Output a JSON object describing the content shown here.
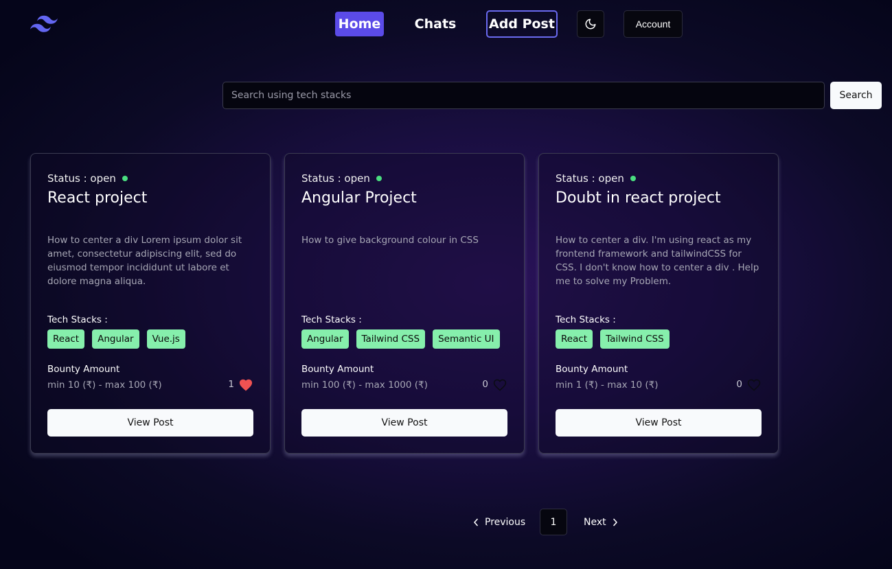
{
  "colors": {
    "accent": "#5b4be8",
    "add_post_border": "#6a6af0",
    "status_open": "#4ade80",
    "tag_bg": "#86efac",
    "heart_filled": "#f05252",
    "logo": "#6366f1"
  },
  "nav": {
    "logo_icon": "tailwind-logo-icon",
    "home_label": "Home",
    "chats_label": "Chats",
    "add_post_label": "Add Post",
    "theme_icon": "moon-icon",
    "account_label": "Account"
  },
  "search": {
    "placeholder": "Search using tech stacks",
    "value": "",
    "button_label": "Search"
  },
  "posts": [
    {
      "status_prefix": "Status : ",
      "status": "open",
      "title": "React project",
      "description": "How to center a div Lorem ipsum dolor sit amet, consectetur adipiscing elit, sed do eiusmod tempor incididunt ut labore et dolore magna aliqua.",
      "tech_label": "Tech Stacks :",
      "tags": [
        "React",
        "Angular",
        "Vue.js"
      ],
      "bounty_label": "Bounty Amount",
      "bounty_range": "min 10 (₹) - max 100 (₹)",
      "likes": "1",
      "liked": true,
      "view_label": "View Post"
    },
    {
      "status_prefix": "Status : ",
      "status": "open",
      "title": "Angular Project",
      "description": "How to give background colour in CSS",
      "tech_label": "Tech Stacks :",
      "tags": [
        "Angular",
        "Tailwind CSS",
        "Semantic UI"
      ],
      "bounty_label": "Bounty Amount",
      "bounty_range": "min 100 (₹) - max 1000 (₹)",
      "likes": "0",
      "liked": false,
      "view_label": "View Post"
    },
    {
      "status_prefix": "Status : ",
      "status": "open",
      "title": "Doubt in react project",
      "description": "How to center a div. I'm using react as my frontend framework and tailwindCSS for CSS. I don't know how to center a div . Help me to solve my Problem.",
      "tech_label": "Tech Stacks :",
      "tags": [
        "React",
        "Tailwind CSS"
      ],
      "bounty_label": "Bounty Amount",
      "bounty_range": "min 1 (₹) - max 10 (₹)",
      "likes": "0",
      "liked": false,
      "view_label": "View Post"
    }
  ],
  "pagination": {
    "prev_label": "Previous",
    "current_page": "1",
    "next_label": "Next"
  }
}
